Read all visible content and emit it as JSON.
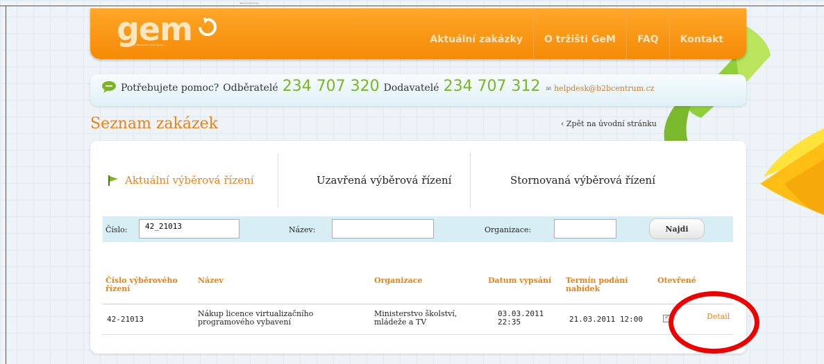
{
  "header": {
    "logo_text": "gem",
    "logo_tagline": "government electronic marketplace",
    "nav": [
      "Aktuální zakázky",
      "O tržišti GeM",
      "FAQ",
      "Kontakt"
    ]
  },
  "help": {
    "question": "Potřebujete pomoc?",
    "buyers_label": "Odběratelé",
    "buyers_phone": "234 707 320",
    "suppliers_label": "Dodavatelé",
    "suppliers_phone": "234 707 312",
    "email": "helpdesk@b2bcentrum.cz"
  },
  "page": {
    "title": "Seznam zakázek",
    "back_link": "‹ Zpět na úvodní stránku"
  },
  "tabs": [
    "Aktuální výběrová řízení",
    "Uzavřená výběrová řízení",
    "Stornovaná výběrová řízení"
  ],
  "search": {
    "number_label": "Číslo:",
    "number_value": "42_21013",
    "name_label": "Název:",
    "name_value": "",
    "org_label": "Organizace:",
    "org_value": "",
    "button": "Najdi"
  },
  "table": {
    "headers": [
      "Číslo výběrového řízení",
      "Název",
      "Organizace",
      "Datum vypsání",
      "Termín podání nabídek",
      "Otevřené"
    ],
    "rows": [
      {
        "number": "42-21013",
        "name": "Nákup licence virtualizačního programového vybavení",
        "organization": "Ministerstvo školství, mládeže a TV",
        "published": "03.03.2011 22:35",
        "deadline": "21.03.2011 12:00",
        "open": true,
        "action": "Detail"
      }
    ]
  },
  "colors": {
    "accent_orange": "#e8831c",
    "phone_green": "#7cb520",
    "highlight_red": "#ee0000"
  }
}
